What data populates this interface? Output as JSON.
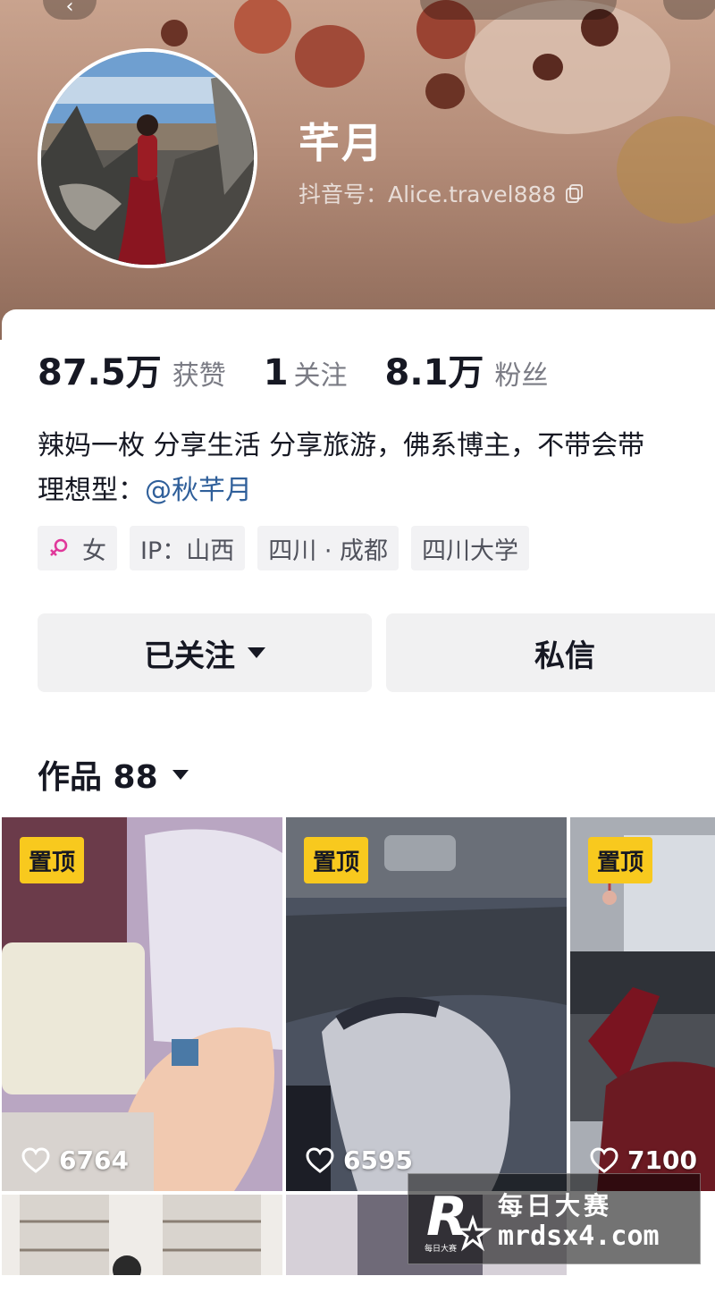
{
  "profile": {
    "nickname": "芊月",
    "douyin_id": "抖音号：Alice.travel888"
  },
  "stats": [
    {
      "value": "87.5万",
      "label": "获赞"
    },
    {
      "value": "1",
      "label": "关注"
    },
    {
      "value": "8.1万",
      "label": "粉丝"
    }
  ],
  "bio": {
    "line1": "辣妈一枚 分享生活 分享旅游，佛系博主，不带会带",
    "line2_prefix": "理想型：",
    "line2_mention": "@秋芊月"
  },
  "tags": {
    "gender": "女",
    "ip": "IP：山西",
    "location": "四川 · 成都",
    "school": "四川大学"
  },
  "actions": {
    "follow_label": "已关注",
    "message_label": "私信"
  },
  "works": {
    "label": "作品 88",
    "items": [
      {
        "pinned_label": "置顶",
        "likes": "6764"
      },
      {
        "pinned_label": "置顶",
        "likes": "6595"
      },
      {
        "pinned_label": "置顶",
        "likes": "7100"
      }
    ]
  },
  "watermark": {
    "title": "每日大赛",
    "url": "mrdsx4.com",
    "logo_text": "每日大赛"
  },
  "colors": {
    "pin_badge": "#f8c91e",
    "mention": "#2f5f9a",
    "gender_icon": "#e0389a"
  }
}
